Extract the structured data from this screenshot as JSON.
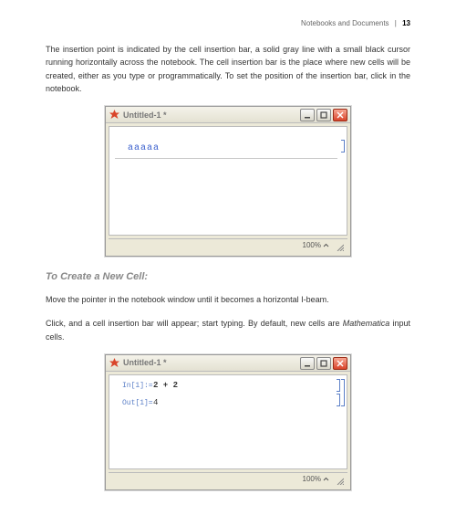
{
  "header": {
    "section_title": "Notebooks and Documents",
    "page_number": "13"
  },
  "paragraphs": {
    "p1": "The insertion point is indicated by the cell insertion bar, a solid gray line with a small black cursor running horizontally across the notebook. The cell insertion bar is the place where new cells will be created, either as you type or programmatically. To set the position of the insertion bar, click in the notebook.",
    "heading": "To Create a New Cell:",
    "p2": "Move the pointer in the notebook window until it becomes a horizontal I-beam.",
    "p3_a": "Click, and a cell insertion bar will appear; start typing. By default, new cells are ",
    "p3_italic": "Mathematica",
    "p3_b": " input cells."
  },
  "notebook1": {
    "title": "Untitled-1 *",
    "content": "aaaaa",
    "zoom": "100%"
  },
  "notebook2": {
    "title": "Untitled-1 *",
    "in_label": "In[1]:=",
    "in_content": "2 + 2",
    "out_label": "Out[1]=",
    "out_content": "4",
    "zoom": "100%"
  }
}
